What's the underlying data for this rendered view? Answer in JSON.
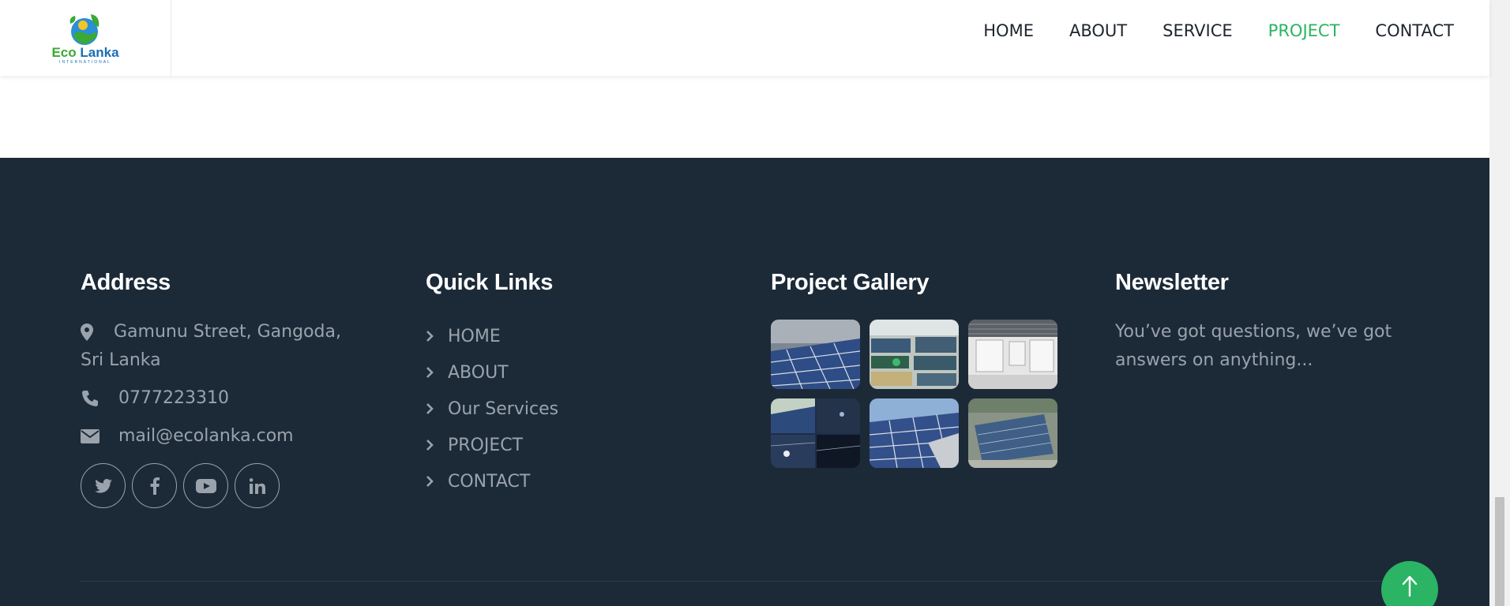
{
  "header": {
    "logo": {
      "brand_eco": "Eco",
      "brand_lanka": "Lanka",
      "brand_sub": "INTERNATIONAL"
    },
    "nav": [
      {
        "label": "HOME",
        "active": false
      },
      {
        "label": "ABOUT",
        "active": false
      },
      {
        "label": "SERVICE",
        "active": false
      },
      {
        "label": "PROJECT",
        "active": true
      },
      {
        "label": "CONTACT",
        "active": false
      }
    ]
  },
  "footer": {
    "address": {
      "title": "Address",
      "street": "Gamunu Street, Gangoda, Sri Lanka",
      "phone": "0777223310",
      "email": "mail@ecolanka.com",
      "socials": [
        "twitter-icon",
        "facebook-icon",
        "youtube-icon",
        "linkedin-icon"
      ]
    },
    "quick_links": {
      "title": "Quick Links",
      "items": [
        "HOME",
        "ABOUT",
        "Our Services",
        "PROJECT",
        "CONTACT"
      ]
    },
    "gallery": {
      "title": "Project Gallery",
      "count": 6
    },
    "newsletter": {
      "title": "Newsletter",
      "text": "You’ve got questions, we’ve got answers on anything..."
    }
  },
  "colors": {
    "accent": "#2ab463",
    "footer_bg": "#1c2a38",
    "footer_text": "#9aa3ab",
    "nav_text": "#1e252d"
  }
}
